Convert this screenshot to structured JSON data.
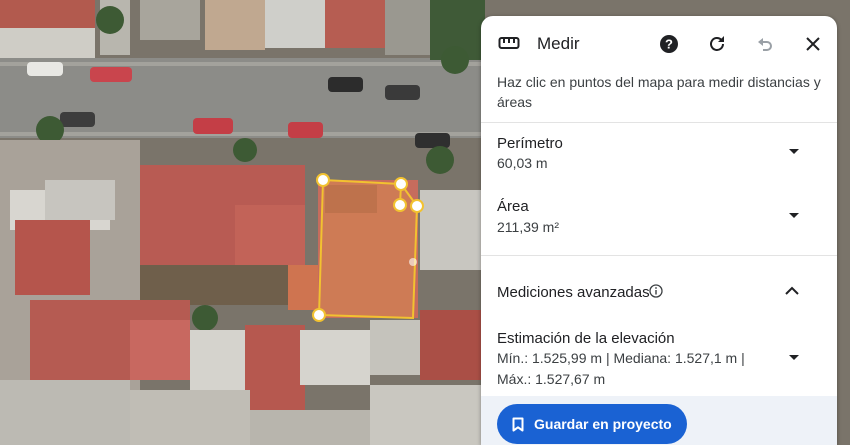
{
  "panel": {
    "title": "Medir",
    "ruler_icon": "ruler-icon",
    "header_icons": [
      "help-icon",
      "refresh-icon",
      "undo-icon",
      "close-icon"
    ],
    "instruction": "Haz clic en puntos del mapa para medir distancias y áreas",
    "perimeter": {
      "label": "Perímetro",
      "value": "60,03 m"
    },
    "area": {
      "label": "Área",
      "value": "211,39 m²"
    },
    "advanced": {
      "label": "Mediciones avanzadas",
      "expanded": true
    },
    "elevation": {
      "label": "Estimación de la elevación",
      "value": "Mín.: 1.525,99 m | Mediana: 1.527,1 m | Máx.: 1.527,67 m"
    },
    "save_button": {
      "label": "Guardar en proyecto",
      "icon": "bookmark-icon"
    }
  },
  "colors": {
    "accent": "#1a62d3",
    "measure_line": "#f2c230",
    "roof_red": "#b95a52"
  }
}
